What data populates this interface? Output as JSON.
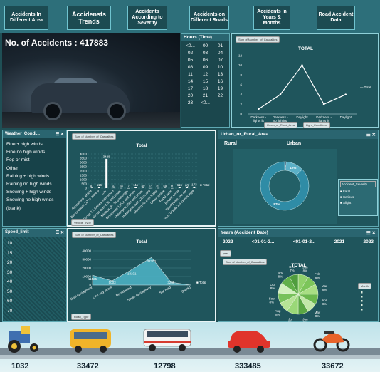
{
  "nav": {
    "items": [
      {
        "label": "Accidents In Different Area"
      },
      {
        "label": "Accidensts Trends"
      },
      {
        "label": "Accidents According to Severity"
      },
      {
        "label": "Accidents on Different Roads"
      },
      {
        "label": "Accidents in Years & Months"
      },
      {
        "label": "Road Accident Data"
      }
    ]
  },
  "hero": {
    "title": "No. of Accidents : 417883"
  },
  "hours": {
    "header": "Hours (Time)",
    "cells": [
      "<0...",
      "00",
      "01",
      "02",
      "03",
      "04",
      "05",
      "06",
      "07",
      "08",
      "09",
      "10",
      "11",
      "12",
      "13",
      "14",
      "15",
      "16",
      "17",
      "18",
      "19",
      "20",
      "21",
      "22",
      "23",
      "<0..."
    ]
  },
  "chart_light": {
    "pill": "Sum of Number_of_Casualties",
    "title": "TOTAL",
    "legend": "Total",
    "filters": [
      "Urban_or_Rural_Area",
      "Light_Conditions"
    ],
    "groups": [
      "Rural",
      "Urban"
    ]
  },
  "chart_data": [
    {
      "type": "line",
      "title": "TOTAL",
      "categories": [
        "Darkness - lights lit",
        "Darkness - no lighting",
        "Daylight",
        "Darkness - lights lit",
        "Daylight"
      ],
      "groups": [
        "Rural",
        "Rural",
        "Rural",
        "Urban",
        "Urban"
      ],
      "series": [
        {
          "name": "Total",
          "values": [
            1,
            4,
            10,
            2,
            4
          ]
        }
      ],
      "ylim": [
        0,
        12
      ],
      "yticks": [
        0,
        2,
        4,
        6,
        8,
        10,
        12
      ]
    },
    {
      "type": "bar",
      "title": "Total",
      "categories": [
        "Agricultural vehicle",
        "Bus or coach (17 or more pass seats)",
        "Car",
        "Goods 7.5 tonnes mgw and over",
        "Goods over 3.5t. and under 7.5t",
        "Minibus (8 - 16 passenger seats)",
        "Motorcycle 125cc and under",
        "Motorcycle 50cc and under",
        "Motorcycle over 125cc and up to 500cc",
        "Motorcycle over 500cc",
        "Other vehicle",
        "Pedal cycle",
        "Ridden horse",
        "Taxi/Private hire car",
        "Van / Goods 3.5 tonnes mgw or under"
      ],
      "series": [
        {
          "name": "Total",
          "values": [
            57,
            116,
            3428,
            37,
            18,
            7,
            111,
            49,
            13,
            20,
            45,
            8,
            116,
            85,
            173
          ]
        }
      ],
      "ylim": [
        0,
        4000
      ],
      "yticks": [
        0,
        500,
        1000,
        1500,
        2000,
        2500,
        3000,
        3500,
        4000
      ],
      "data_labels": [
        "57",
        "116",
        "3428",
        "37",
        "18",
        "7",
        "111",
        "49",
        "13",
        "20",
        "45",
        "8",
        "116",
        "85",
        "173"
      ]
    },
    {
      "type": "pie",
      "subtype": "donut",
      "labels": [
        "Fatal",
        "Serious",
        "Slight"
      ],
      "values": [
        1,
        12,
        87
      ],
      "data_labels": [
        "1%",
        "12%",
        "87%"
      ]
    },
    {
      "type": "area",
      "title": "Total",
      "categories": [
        "Dual carriageway",
        "One way street",
        "Roundabout",
        "Single carriageway",
        "Slip road",
        "(blank)"
      ],
      "series": [
        {
          "name": "Total",
          "values": [
            11525,
            5003,
            18101,
            32300,
            3245,
            0
          ]
        }
      ],
      "ylim": [
        0,
        40000
      ],
      "yticks": [
        0,
        10000,
        20000,
        30000,
        40000
      ],
      "data_labels": [
        "11525",
        "5003",
        "18101",
        "32300",
        "3245",
        ""
      ]
    },
    {
      "type": "pie",
      "title": "TOTAL",
      "labels": [
        "Jan",
        "Feb",
        "Mar",
        "Apr",
        "May",
        "Jun",
        "Jul",
        "Aug",
        "Sep",
        "Oct",
        "Nov",
        "Dec"
      ],
      "values": [
        8,
        8,
        8,
        8,
        8,
        8,
        9,
        8,
        8,
        8,
        8,
        7
      ],
      "data_labels": [
        "8%",
        "8%",
        "8%",
        "8%",
        "8%",
        "8%",
        "9%",
        "8%",
        "8%",
        "8%",
        "8%",
        "7%"
      ]
    }
  ],
  "weather": {
    "header": "Weather_Condi...",
    "items": [
      "Fine + high winds",
      "Fine no high winds",
      "Fog or mist",
      "Other",
      "Raining + high winds",
      "Raining no high winds",
      "Snowing + high winds",
      "Snowing no high winds",
      "(blank)"
    ]
  },
  "vehicle_chart": {
    "pill": "Sum of Number_of_Casualties",
    "title": "Total",
    "legend": "Total",
    "filter": "Vehicle_Type"
  },
  "speed": {
    "header": "Speed_limit",
    "items": [
      "10",
      "15",
      "20",
      "30",
      "40",
      "50",
      "60",
      "70"
    ]
  },
  "road_chart": {
    "pill": "Sum of Number_of_Casualties",
    "title": "Total",
    "legend": "Total",
    "filter": "Road_Type"
  },
  "urban": {
    "header": "Urban_or_Rural_Area",
    "options": [
      "Rural",
      "Urban"
    ],
    "legend_title": "Accident_Severity",
    "legend": [
      "Fatal",
      "Serious",
      "Slight"
    ],
    "colors": {
      "fatal": "#1a3f5c",
      "serious": "#5bb0c7",
      "slight": "#2f8ca6"
    }
  },
  "years": {
    "header": "Years (Accident Date)",
    "options": [
      "2022",
      "<01-01-2...",
      "<01-01-2...",
      "2021",
      "2023"
    ],
    "pill_year": "year",
    "pill_sum": "Sum of Number_of_Casualties",
    "title": "TOTAL",
    "legend_title": "Month"
  },
  "bottom": {
    "counts": [
      "1032",
      "33472",
      "12798",
      "333485",
      "33672"
    ],
    "vehicles": [
      "tractor-icon",
      "bus-icon",
      "coach-icon",
      "car-icon",
      "motorcycle-icon"
    ]
  }
}
